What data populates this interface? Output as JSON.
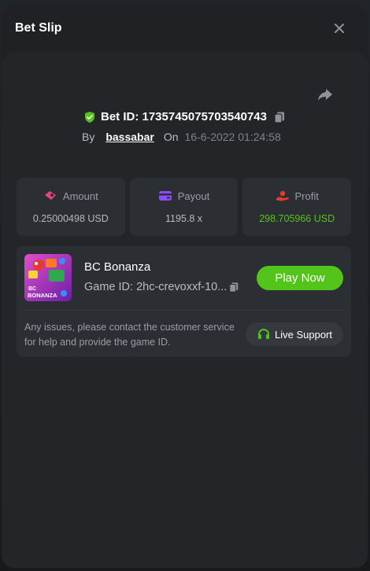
{
  "header": {
    "title": "Bet Slip",
    "close_icon": "close-icon"
  },
  "bet": {
    "id_label": "Bet ID: 1735745075703540743",
    "by_label": "By",
    "username": "bassabar",
    "on_label": "On",
    "date": "16-6-2022 01:24:58"
  },
  "stats": [
    {
      "label": "Amount",
      "value": "0.25000498 USD",
      "icon": "amount-icon",
      "color": "#e8457a"
    },
    {
      "label": "Payout",
      "value": "1195.8 x",
      "icon": "payout-card-icon",
      "color": "#8b4dff"
    },
    {
      "label": "Profit",
      "value": "298.705966 USD",
      "icon": "profit-icon",
      "color": "#e8392f",
      "value_color": "#52c41a"
    }
  ],
  "game": {
    "name": "BC Bonanza",
    "id_label": "Game ID: 2hc-crevoxxf-10...",
    "play_label": "Play Now",
    "thumb_text": "BC BONANZA",
    "support_text": "Any issues, please contact the customer service for help and provide the game ID.",
    "support_label": "Live Support"
  },
  "colors": {
    "accent_green": "#52c41a",
    "panel": "#2b2e33",
    "background": "#1f2124"
  }
}
